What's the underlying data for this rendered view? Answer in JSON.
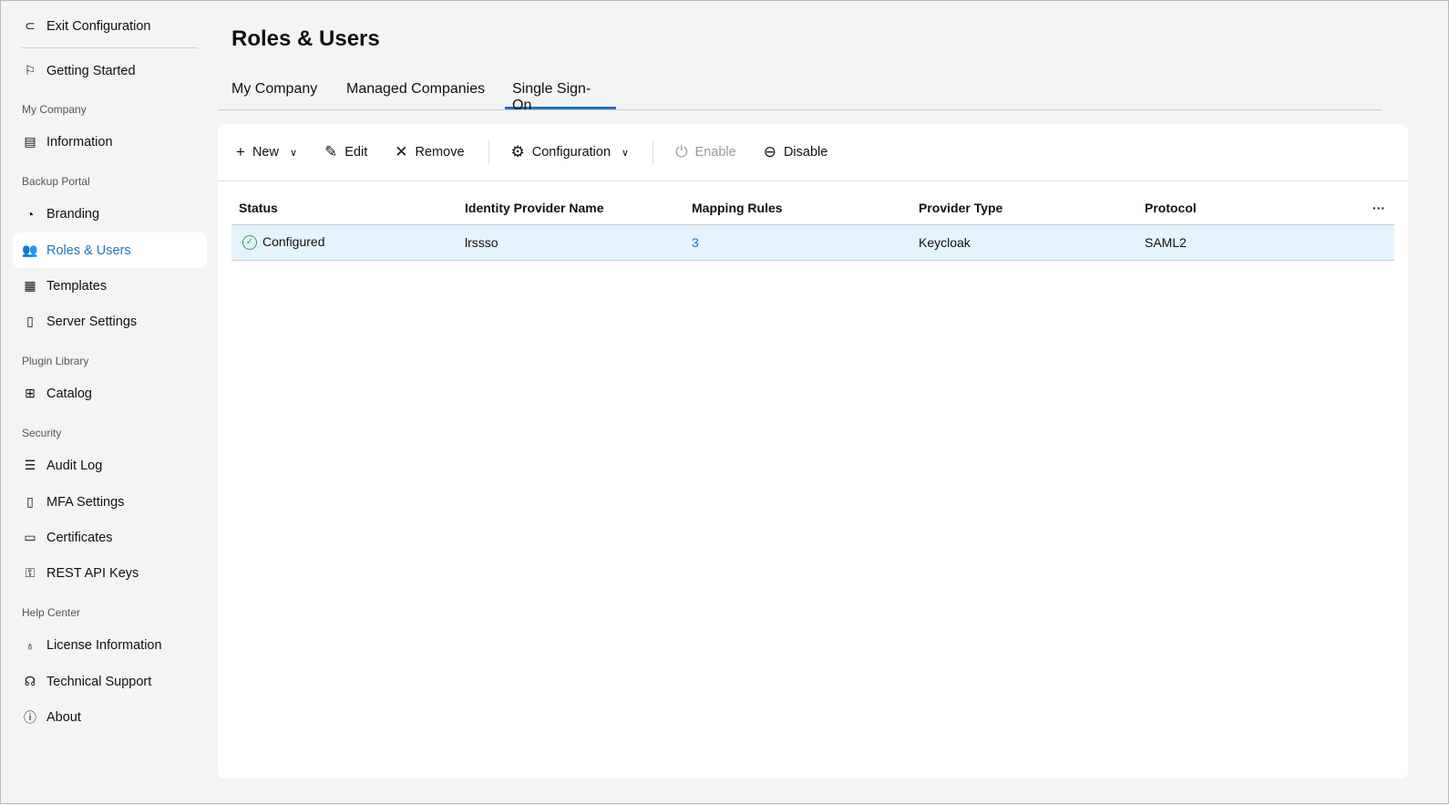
{
  "sidebar": {
    "exit": "Exit Configuration",
    "getting_started": "Getting Started",
    "sections": [
      "My Company",
      "Backup Portal",
      "Plugin Library",
      "Security",
      "Help Center"
    ],
    "items": [
      "Information",
      "Branding",
      "Roles & Users",
      "Templates",
      "Server Settings",
      "Catalog",
      "Audit Log",
      "MFA Settings",
      "Certificates",
      "REST API Keys",
      "License Information",
      "Technical Support",
      "About"
    ]
  },
  "header": {
    "title": "Roles & Users"
  },
  "tabs": [
    "My Company",
    "Managed Companies",
    "Single Sign-On"
  ],
  "toolbar": {
    "new": "New",
    "edit": "Edit",
    "remove": "Remove",
    "configuration": "Configuration",
    "enable": "Enable",
    "disable": "Disable",
    "more": "···"
  },
  "table": {
    "columns": [
      "Status",
      "Identity Provider Name",
      "Mapping Rules",
      "Provider Type",
      "Protocol"
    ],
    "rows": [
      {
        "status": "Configured",
        "name": "lrssso",
        "rules": "3",
        "type": "Keycloak",
        "protocol": "SAML2"
      }
    ]
  },
  "colors": {
    "accent": "#1f72c0",
    "success": "#2ea44f"
  }
}
